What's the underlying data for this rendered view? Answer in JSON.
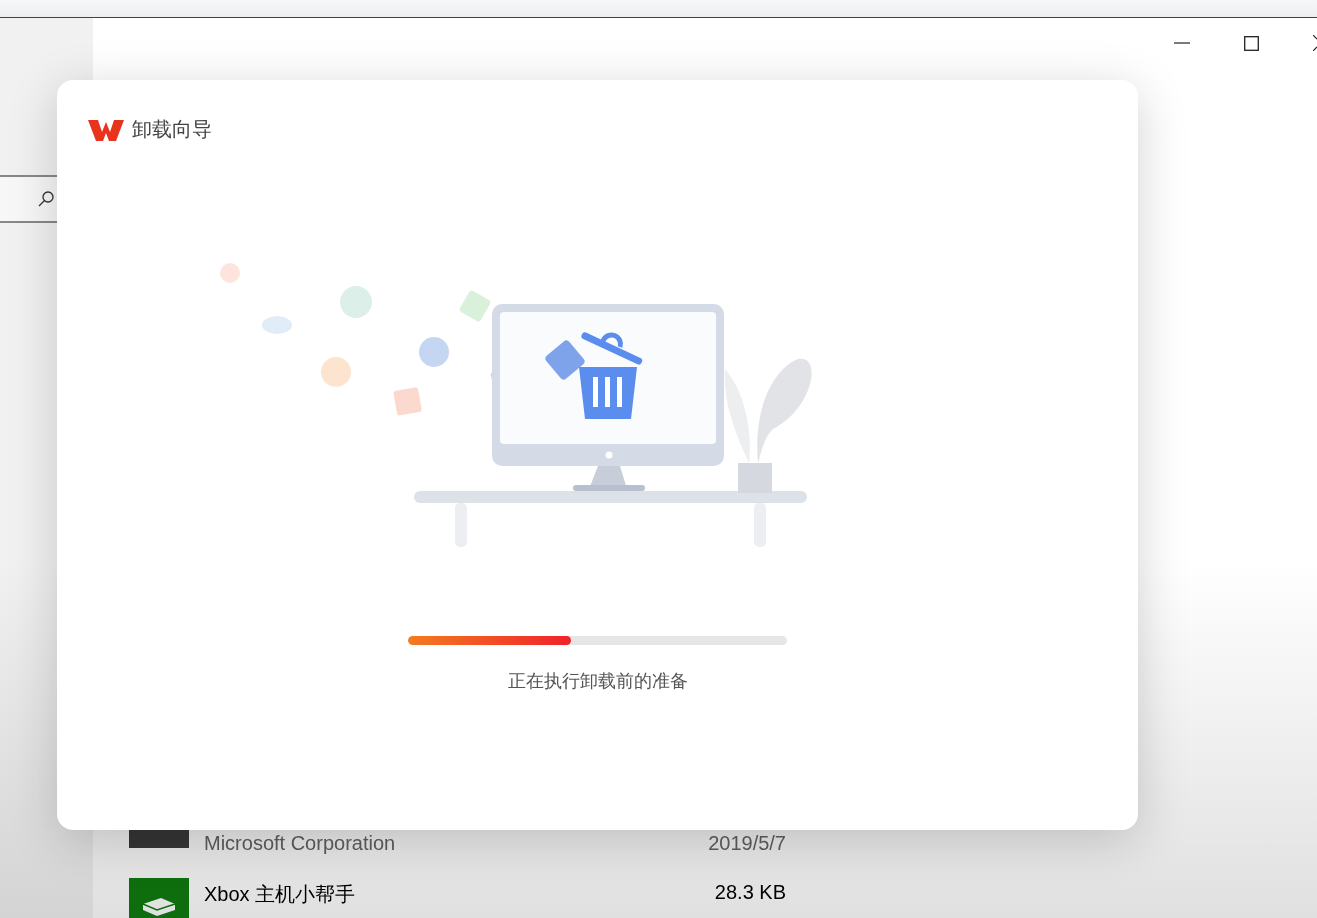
{
  "background_window": {
    "apps": [
      {
        "publisher": "Microsoft Corporation",
        "date": "2019/5/7",
        "kind": "console"
      },
      {
        "name": "Xbox 主机小帮手",
        "size": "28.3 KB",
        "kind": "xbox"
      }
    ]
  },
  "dialog": {
    "title": "卸载向导",
    "progress": {
      "level": 0.43
    },
    "status": "正在执行卸载前的准备"
  }
}
